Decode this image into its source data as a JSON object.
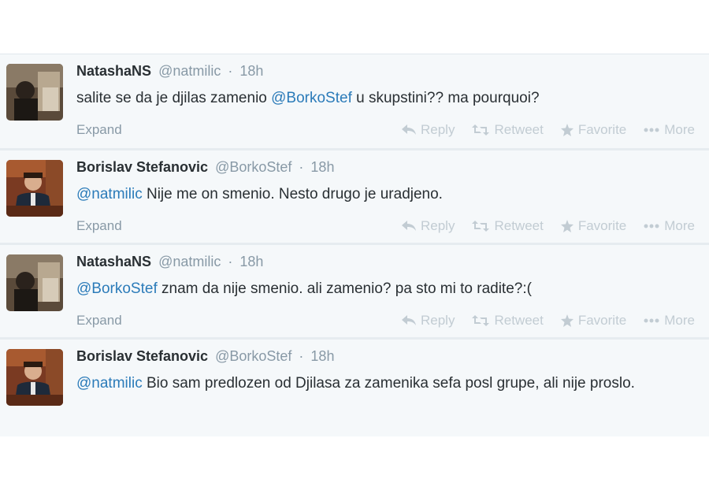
{
  "tweets": [
    {
      "fullname": "NatashaNS",
      "username": "@natmilic",
      "separator": "·",
      "time": "18h",
      "text_before": "salite se da je djilas zamenio ",
      "mention": "@BorkoStef",
      "text_after": " u skupstini?? ma pourquoi?",
      "avatar_icon": "natasha-avatar"
    },
    {
      "fullname": "Borislav Stefanovic",
      "username": "@BorkoStef",
      "separator": "·",
      "time": "18h",
      "text_before": "",
      "mention": "@natmilic",
      "text_after": " Nije me on smenio. Nesto drugo je uradjeno.",
      "avatar_icon": "borislav-avatar"
    },
    {
      "fullname": "NatashaNS",
      "username": "@natmilic",
      "separator": "·",
      "time": "18h",
      "text_before": "",
      "mention": "@BorkoStef",
      "text_after": " znam da nije smenio. ali zamenio? pa sto mi to radite?:(",
      "avatar_icon": "natasha-avatar"
    },
    {
      "fullname": "Borislav Stefanovic",
      "username": "@BorkoStef",
      "separator": "·",
      "time": "18h",
      "text_before": "",
      "mention": "@natmilic",
      "text_after": " Bio sam predlozen od Djilasa za zamenika sefa posl grupe, ali nije proslo.",
      "avatar_icon": "borislav-avatar"
    }
  ],
  "actions": {
    "expand": "Expand",
    "reply": "Reply",
    "retweet": "Retweet",
    "favorite": "Favorite",
    "more": "More"
  },
  "colors": {
    "mention": "#2b7bb9",
    "muted": "#8899a6",
    "action": "#c2ccd3",
    "tweet_bg": "#f5f8fa"
  }
}
